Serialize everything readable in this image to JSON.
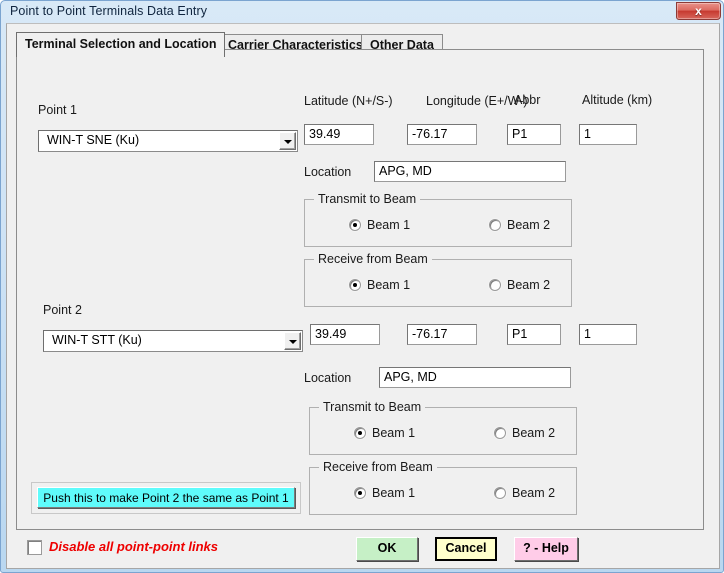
{
  "window": {
    "title": "Point to Point Terminals Data Entry",
    "close_label": "x"
  },
  "tabs": [
    {
      "label": "Terminal Selection and Location",
      "active": true
    },
    {
      "label": "Carrier Characteristics",
      "active": false
    },
    {
      "label": "Other Data",
      "active": false
    }
  ],
  "column_headers": {
    "latitude": "Latitude (N+/S-)",
    "longitude": "Longitude (E+/W-)",
    "abbr": "Abbr",
    "altitude": "Altitude (km)"
  },
  "labels": {
    "point1": "Point 1",
    "point2": "Point 2",
    "location": "Location",
    "transmit_to_beam": "Transmit to Beam",
    "receive_from_beam": "Receive from Beam",
    "beam1": "Beam 1",
    "beam2": "Beam 2"
  },
  "point1": {
    "terminal": "WIN-T SNE (Ku)",
    "latitude": "39.49",
    "longitude": "-76.17",
    "abbr": "P1",
    "altitude": "1",
    "location": "APG, MD",
    "transmit_beam": "Beam 1",
    "receive_beam": "Beam 1"
  },
  "point2": {
    "terminal": "WIN-T STT (Ku)",
    "latitude": "39.49",
    "longitude": "-76.17",
    "abbr": "P1",
    "altitude": "1",
    "location": "APG, MD",
    "transmit_beam": "Beam 1",
    "receive_beam": "Beam 1"
  },
  "sync_button": {
    "label": "Push this to make Point 2 the same as Point 1"
  },
  "footer": {
    "disable_links_label": "Disable all point-point links",
    "disable_links_checked": false,
    "ok_label": "OK",
    "cancel_label": "Cancel",
    "help_label": "? - Help"
  },
  "colors": {
    "sync_button": "#5ffbfb",
    "ok_button": "#c6f0c6",
    "cancel_button": "#ffffcc",
    "help_button": "#ffcce8",
    "disable_label": "#ee0000",
    "close_button": "#c6392f"
  }
}
